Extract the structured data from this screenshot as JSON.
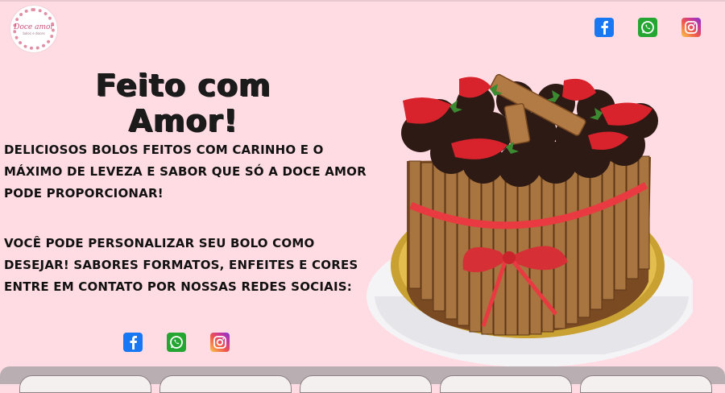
{
  "header": {
    "logo": {
      "script": "Doce amor",
      "sub": "bolos e doces"
    },
    "social": [
      {
        "name": "facebook",
        "icon": "facebook-icon",
        "color": "#1877f2"
      },
      {
        "name": "whatsapp",
        "icon": "whatsapp-icon",
        "color": "#25a532"
      },
      {
        "name": "instagram",
        "icon": "instagram-icon",
        "color": "#e1306c"
      }
    ]
  },
  "hero": {
    "title": "Feito com Amor!",
    "paragraph1": "Deliciosos bolos feitos com carinho e o máximo de leveza e sabor que só a Doce Amor pode proporcionar!",
    "paragraph2": "Você pode personalizar seu bolo como desejar! Sabores formatos, enfeites e cores entre em contato por nossas redes sociais:"
  },
  "footer_social": [
    {
      "name": "facebook",
      "icon": "facebook-icon"
    },
    {
      "name": "whatsapp",
      "icon": "whatsapp-icon"
    },
    {
      "name": "instagram",
      "icon": "instagram-icon"
    }
  ],
  "colors": {
    "background": "#ffdce3",
    "text": "#111111",
    "ribbon": "#e83a40"
  }
}
